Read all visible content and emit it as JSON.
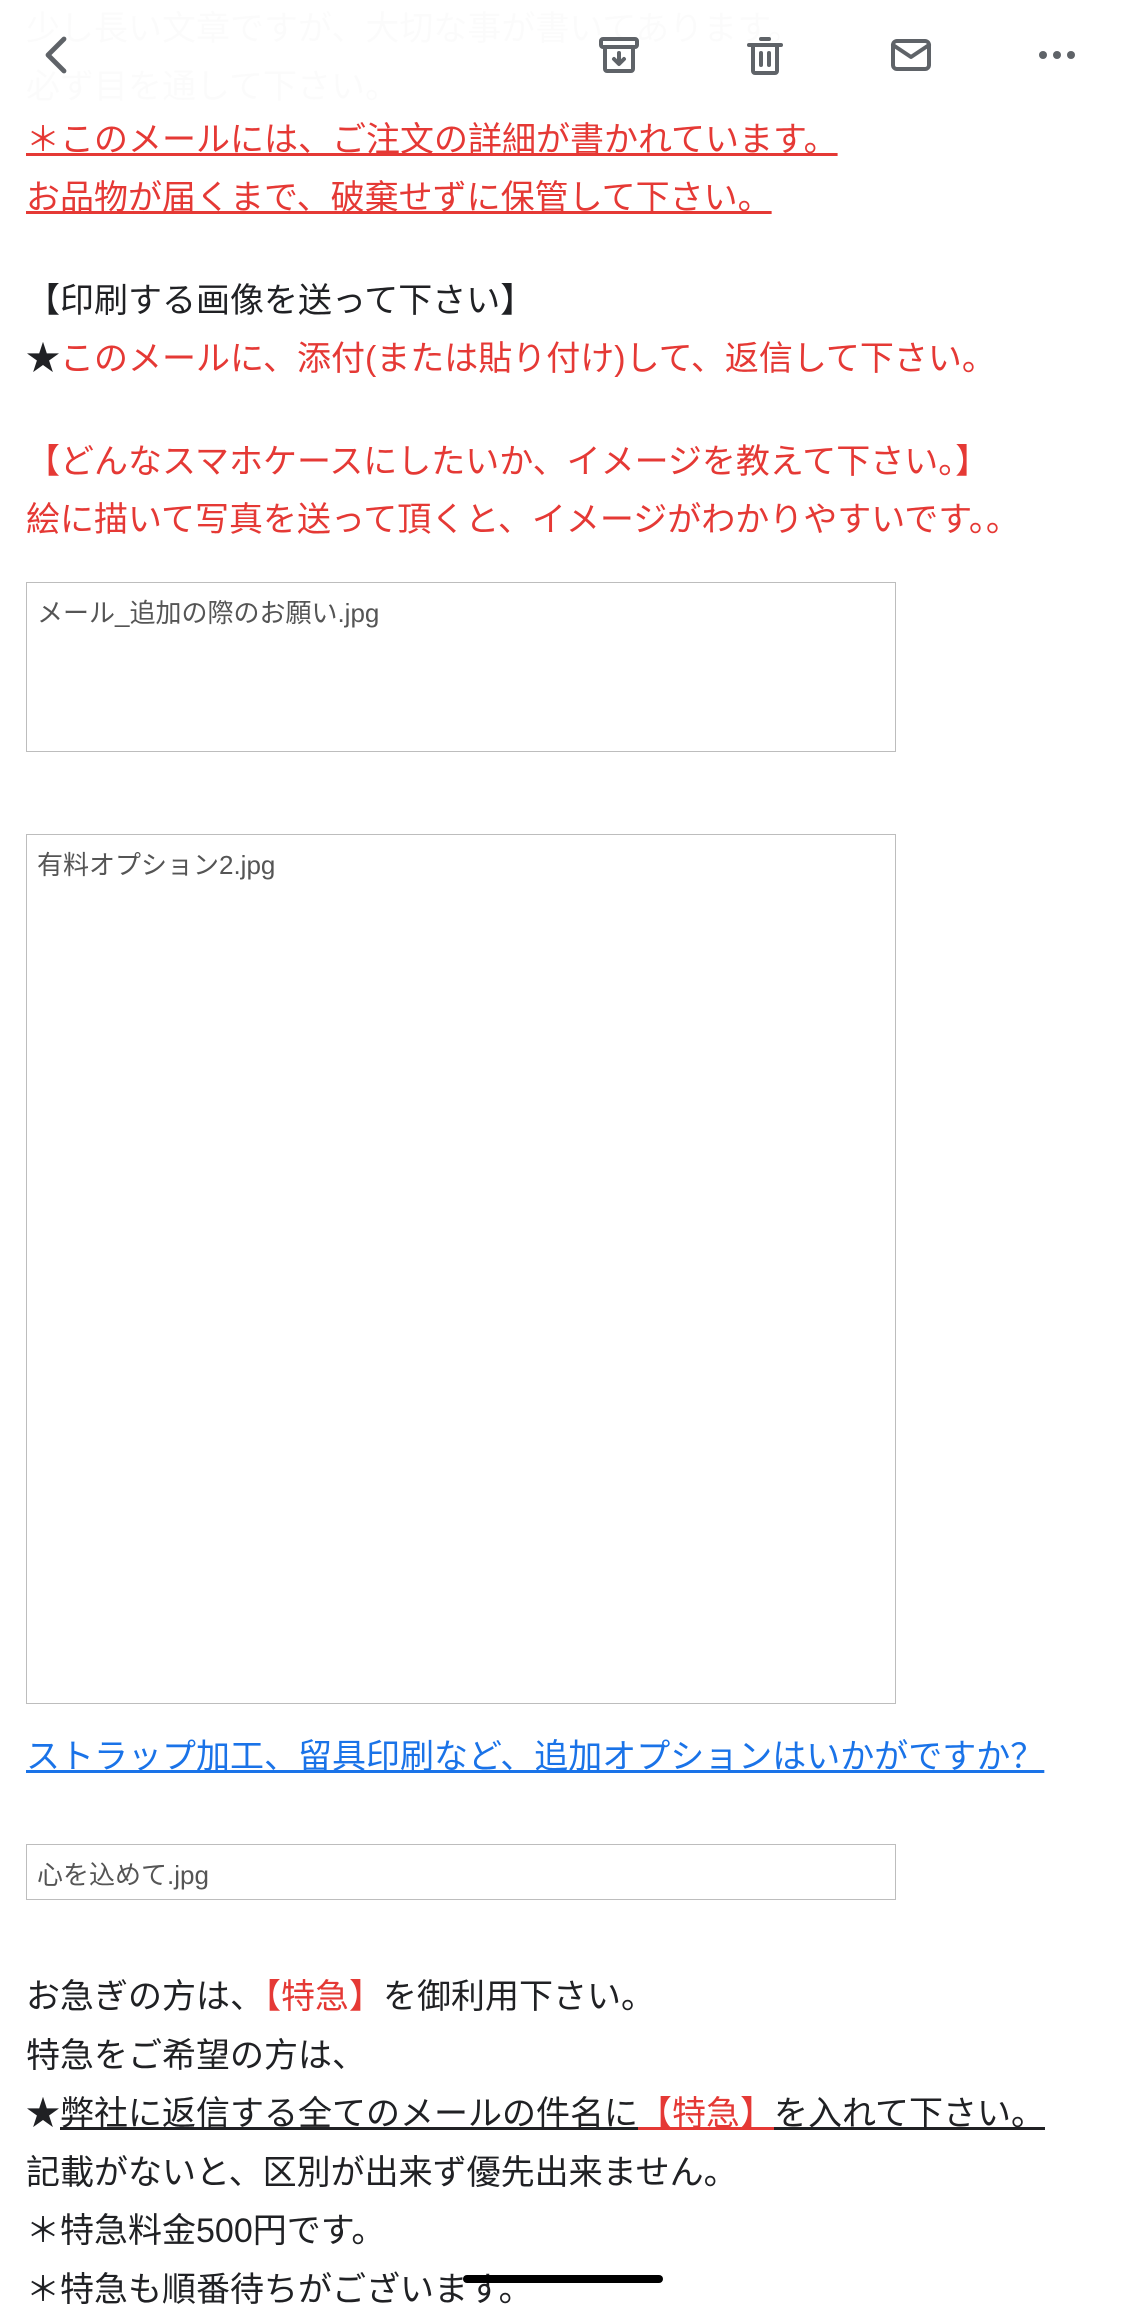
{
  "toolbar": {
    "back": "back",
    "archive": "archive",
    "delete": "delete",
    "mail": "mail",
    "more": "more"
  },
  "body": {
    "faded1": "少し長い文章ですが、大切な事が書いてあります。",
    "faded2": "必ず目を通して下さい。",
    "warn1": "＊このメールには、ご注文の詳細が書かれています。",
    "warn2": "お品物が届くまで、破棄せずに保管して下さい。",
    "h1": "【印刷する画像を送って下さい】",
    "inst1": "このメールに、添付(または貼り付け)して、返信して下さい。",
    "h2": "【どんなスマホケースにしたいか、イメージを教えて下さい。】",
    "inst2": "絵に描いて写真を送って頂くと、イメージがわかりやすいです。。",
    "attach1": "メール_追加の際のお願い.jpg",
    "attach2": "有料オプション2.jpg",
    "link1": "ストラップ加工、留具印刷など、追加オプションはいかがですか？",
    "attach3": "心を込めて.jpg",
    "hurry1a": "お急ぎの方は、",
    "hurry1b": "【特急】",
    "hurry1c": "を御利用下さい。",
    "hurry2": "特急をご希望の方は、",
    "hurry3a": "弊社に返信する全てのメールの件名に",
    "hurry3b": "【特急】",
    "hurry3c": "を入れて下さい。",
    "hurry4": "記載がないと、区別が出来ず優先出来ません。",
    "hurry5": "＊特急料金500円です。",
    "hurry6": "＊特急も順番待ちがございます。"
  }
}
